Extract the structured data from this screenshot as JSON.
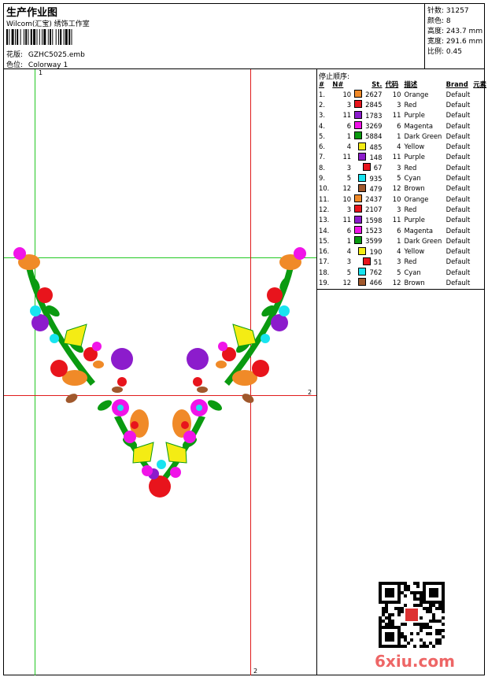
{
  "header": {
    "title": "生产作业图",
    "subtitle": "Wilcom(汇宝) 绣饰工作室",
    "design_label": "花版:",
    "design_value": "GZHC5025.emb",
    "colorway_label": "色位:",
    "colorway_value": "Colorway 1"
  },
  "stats": {
    "stitches_label": "针数:",
    "stitches_value": "31257",
    "colors_label": "颜色:",
    "colors_value": "8",
    "height_label": "高度:",
    "height_value": "243.7 mm",
    "width_label": "宽度:",
    "width_value": "291.6 mm",
    "scale_label": "比例:",
    "scale_value": "0.45"
  },
  "stoplist": {
    "title": "停止顺序:",
    "headers": [
      "#",
      "N#",
      "St.",
      "代码",
      "描述",
      "Brand",
      "元素"
    ],
    "rows": [
      {
        "idx": "1.",
        "n": "10",
        "st": "2627",
        "code": "10",
        "desc": "Orange",
        "brand": "Default",
        "color": "#f08a28"
      },
      {
        "idx": "2.",
        "n": "3",
        "st": "2845",
        "code": "3",
        "desc": "Red",
        "brand": "Default",
        "color": "#e8141c"
      },
      {
        "idx": "3.",
        "n": "11",
        "st": "1783",
        "code": "11",
        "desc": "Purple",
        "brand": "Default",
        "color": "#8c1ccc"
      },
      {
        "idx": "4.",
        "n": "6",
        "st": "3269",
        "code": "6",
        "desc": "Magenta",
        "brand": "Default",
        "color": "#f014e8"
      },
      {
        "idx": "5.",
        "n": "1",
        "st": "5884",
        "code": "1",
        "desc": "Dark Green",
        "brand": "Default",
        "color": "#0a9a10"
      },
      {
        "idx": "6.",
        "n": "4",
        "st": "485",
        "code": "4",
        "desc": "Yellow",
        "brand": "Default",
        "color": "#f4ec14"
      },
      {
        "idx": "7.",
        "n": "11",
        "st": "148",
        "code": "11",
        "desc": "Purple",
        "brand": "Default",
        "color": "#8c1ccc"
      },
      {
        "idx": "8.",
        "n": "3",
        "st": "67",
        "code": "3",
        "desc": "Red",
        "brand": "Default",
        "color": "#e8141c"
      },
      {
        "idx": "9.",
        "n": "5",
        "st": "935",
        "code": "5",
        "desc": "Cyan",
        "brand": "Default",
        "color": "#18e4f0"
      },
      {
        "idx": "10.",
        "n": "12",
        "st": "479",
        "code": "12",
        "desc": "Brown",
        "brand": "Default",
        "color": "#a0582c"
      },
      {
        "idx": "11.",
        "n": "10",
        "st": "2437",
        "code": "10",
        "desc": "Orange",
        "brand": "Default",
        "color": "#f08a28"
      },
      {
        "idx": "12.",
        "n": "3",
        "st": "2107",
        "code": "3",
        "desc": "Red",
        "brand": "Default",
        "color": "#e8141c"
      },
      {
        "idx": "13.",
        "n": "11",
        "st": "1598",
        "code": "11",
        "desc": "Purple",
        "brand": "Default",
        "color": "#8c1ccc"
      },
      {
        "idx": "14.",
        "n": "6",
        "st": "1523",
        "code": "6",
        "desc": "Magenta",
        "brand": "Default",
        "color": "#f014e8"
      },
      {
        "idx": "15.",
        "n": "1",
        "st": "3599",
        "code": "1",
        "desc": "Dark Green",
        "brand": "Default",
        "color": "#0a9a10"
      },
      {
        "idx": "16.",
        "n": "4",
        "st": "190",
        "code": "4",
        "desc": "Yellow",
        "brand": "Default",
        "color": "#f4ec14"
      },
      {
        "idx": "17.",
        "n": "3",
        "st": "51",
        "code": "3",
        "desc": "Red",
        "brand": "Default",
        "color": "#e8141c"
      },
      {
        "idx": "18.",
        "n": "5",
        "st": "762",
        "code": "5",
        "desc": "Cyan",
        "brand": "Default",
        "color": "#18e4f0"
      },
      {
        "idx": "19.",
        "n": "12",
        "st": "466",
        "code": "12",
        "desc": "Brown",
        "brand": "Default",
        "color": "#a0582c"
      }
    ]
  },
  "guides": {
    "label_v1": "1",
    "label_h2": "2",
    "label_v2": "2"
  },
  "watermark": "6xiu.com",
  "icons": {
    "barcode": "barcode-icon",
    "qr": "qr-code-icon",
    "design": "embroidery-design-icon"
  }
}
